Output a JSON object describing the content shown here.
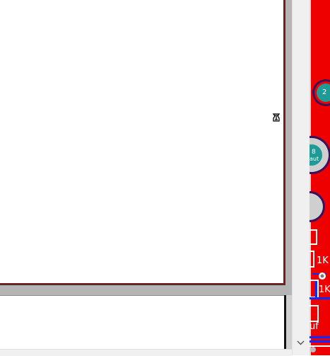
{
  "pcb": {
    "pad_labels": [
      "2",
      "8",
      "aut"
    ],
    "component_labels": [
      "1K",
      "1K",
      "uf"
    ]
  },
  "colors": {
    "sheet_border": "#7a1a1a",
    "gutter": "#b4b4b4",
    "pcb_background": "#ee0000",
    "pad_fill": "#1f9a96",
    "pad_ring": "#3b0f5a",
    "trace_blue": "#0a2cff"
  },
  "icons": [
    "anchor-icon",
    "chevron-down-icon"
  ]
}
